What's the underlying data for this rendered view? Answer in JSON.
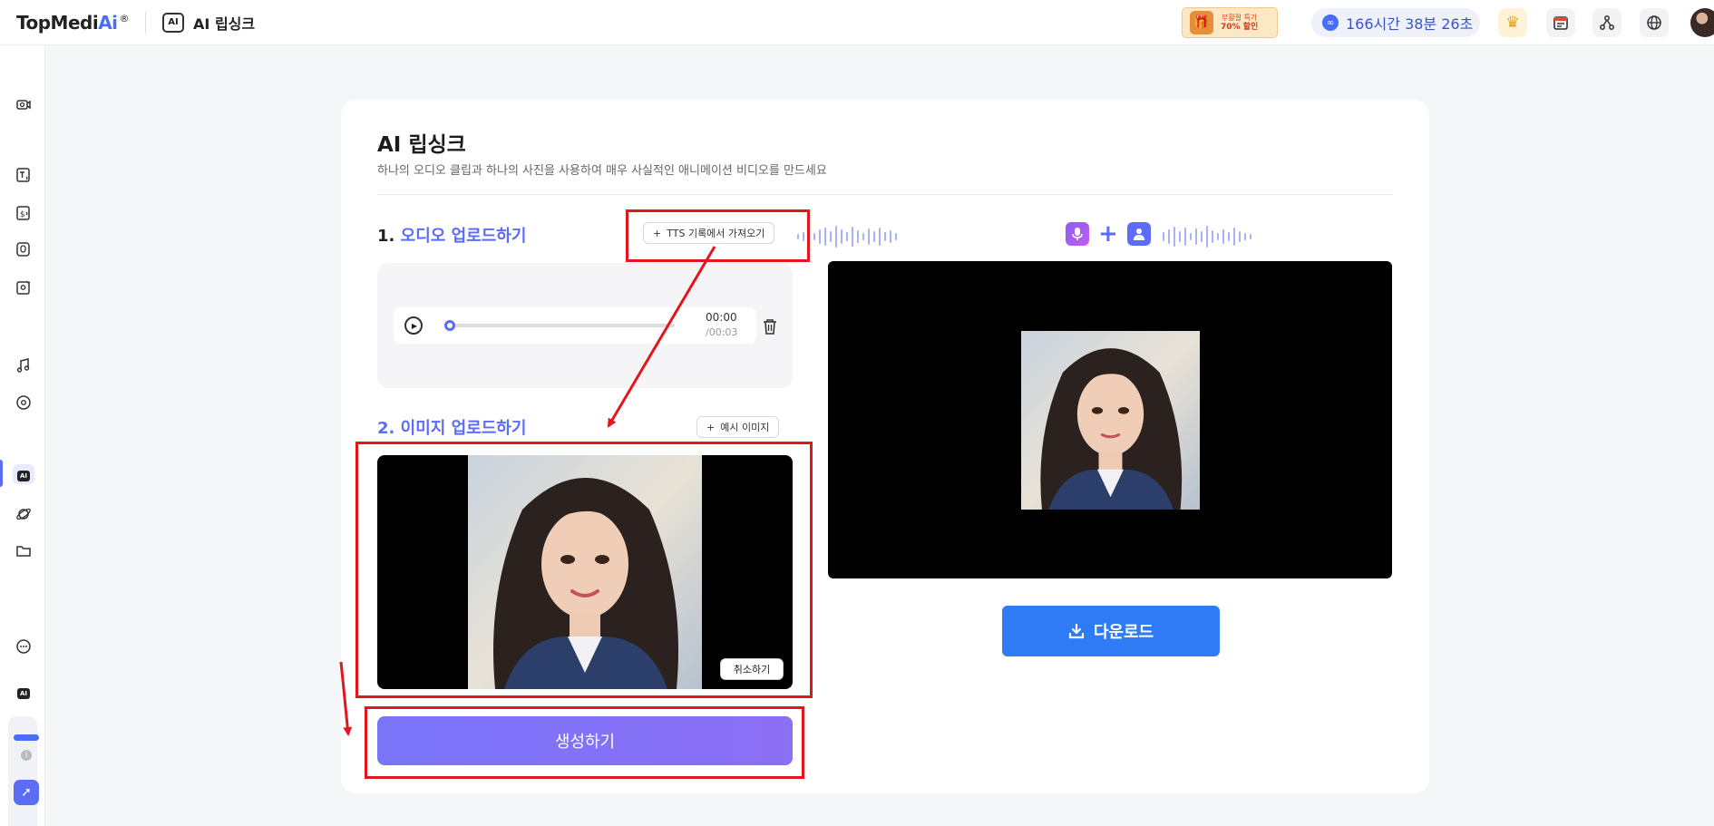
{
  "header": {
    "logo_text": "TopMedi",
    "logo_accent": "Ai",
    "logo_reg": "®",
    "app_title": "AI 립싱크",
    "app_icon_label": "AI",
    "promo_line1": "부활절 특가",
    "promo_line2": "70% 할인",
    "timer": "166시간 38분 26초"
  },
  "sidebar": {
    "ai_chip": "AI"
  },
  "main": {
    "title": "AI 립싱크",
    "subtitle": "하나의 오디오 클립과 하나의 사진을 사용하여 매우 사실적인 애니메이션 비디오를 만드세요",
    "audio_section": {
      "number": "1.",
      "title": "오디오 업로드하기",
      "tts_button": "TTS 기록에서 가져오기",
      "current_time": "00:00",
      "duration": "/00:03",
      "progress": 0
    },
    "image_section": {
      "number": "2.",
      "title": "이미지 업로드하기",
      "sample_button": "예시 이미지",
      "cancel_button": "취소하기"
    },
    "generate_button": "생성하기",
    "download_button": "다운로드"
  },
  "colors": {
    "accent": "#5b6cf7",
    "download": "#2f7bf6",
    "annotation": "#e3151d"
  }
}
